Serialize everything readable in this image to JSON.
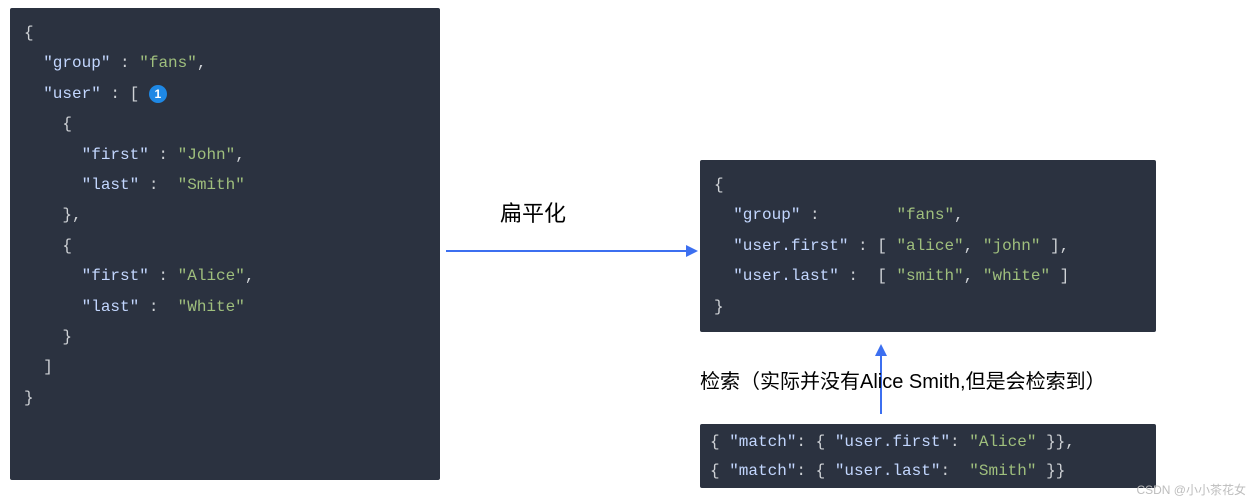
{
  "left": {
    "l1": "{",
    "l2_key": "\"group\"",
    "l2_sep": " : ",
    "l2_val": "\"fans\"",
    "l2_end": ",",
    "l3_key": "\"user\"",
    "l3_sep": " : [ ",
    "badge": "1",
    "l4": "    {",
    "l5_key": "\"first\"",
    "l5_sep": " : ",
    "l5_val": "\"John\"",
    "l5_end": ",",
    "l6_key": "\"last\"",
    "l6_sep": " :  ",
    "l6_val": "\"Smith\"",
    "l7": "    },",
    "l8": "    {",
    "l9_key": "\"first\"",
    "l9_sep": " : ",
    "l9_val": "\"Alice\"",
    "l9_end": ",",
    "l10_key": "\"last\"",
    "l10_sep": " :  ",
    "l10_val": "\"White\"",
    "l11": "    }",
    "l12": "  ]",
    "l13": "}"
  },
  "label_flatten": "扁平化",
  "right_top": {
    "l1": "{",
    "l2_key": "\"group\"",
    "l2_sep": " :        ",
    "l2_val": "\"fans\"",
    "l2_end": ",",
    "l3_key": "\"user.first\"",
    "l3_sep": " : [ ",
    "l3_v1": "\"alice\"",
    "l3_c": ", ",
    "l3_v2": "\"john\"",
    "l3_end": " ],",
    "l4_key": "\"user.last\"",
    "l4_sep": " :  [ ",
    "l4_v1": "\"smith\"",
    "l4_c": ", ",
    "l4_v2": "\"white\"",
    "l4_end": " ]",
    "l5": "}"
  },
  "label_search": "检索（实际并没有Alice Smith,但是会检索到）",
  "right_bottom": {
    "l1_open": "{ ",
    "l1_match": "\"match\"",
    "l1_sep1": ": { ",
    "l1_field": "\"user.first\"",
    "l1_sep2": ": ",
    "l1_val": "\"Alice\"",
    "l1_end": " }},",
    "l2_open": "{ ",
    "l2_match": "\"match\"",
    "l2_sep1": ": { ",
    "l2_field": "\"user.last\"",
    "l2_sep2": ":  ",
    "l2_val": "\"Smith\"",
    "l2_end": " }}"
  },
  "watermark": "CSDN @小小茶花女"
}
